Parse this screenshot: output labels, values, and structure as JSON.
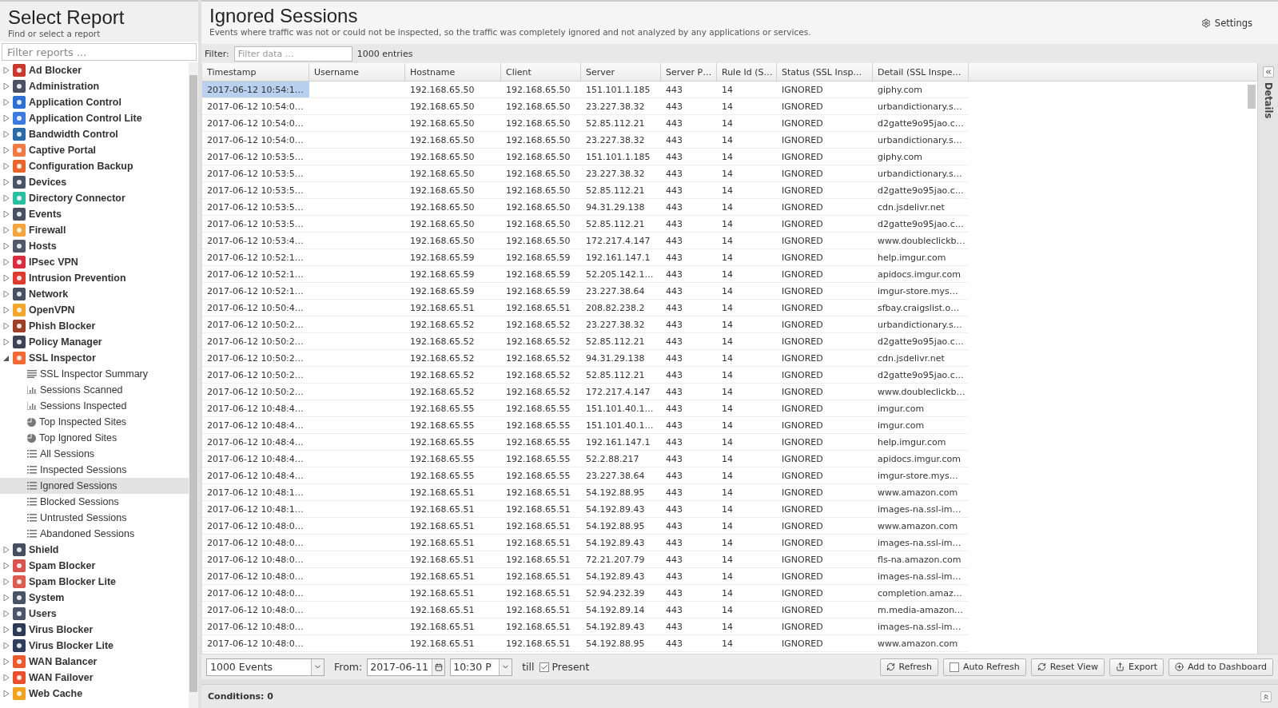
{
  "sidebar": {
    "title": "Select Report",
    "subtitle": "Find or select a report",
    "filter": {
      "placeholder": "Filter reports ..."
    },
    "items": [
      {
        "label": "Ad Blocker",
        "color": "#c83a2e",
        "expanded": false,
        "selected": false
      },
      {
        "label": "Administration",
        "color": "#4a5263",
        "expanded": false,
        "selected": false
      },
      {
        "label": "Application Control",
        "color": "#2f6fd6",
        "expanded": false,
        "selected": false
      },
      {
        "label": "Application Control Lite",
        "color": "#3b7be0",
        "expanded": false,
        "selected": false
      },
      {
        "label": "Bandwidth Control",
        "color": "#2a6aa6",
        "expanded": false,
        "selected": false
      },
      {
        "label": "Captive Portal",
        "color": "#ee7a45",
        "expanded": false,
        "selected": false
      },
      {
        "label": "Configuration Backup",
        "color": "#e4662a",
        "expanded": false,
        "selected": false
      },
      {
        "label": "Devices",
        "color": "#4b5466",
        "expanded": false,
        "selected": false
      },
      {
        "label": "Directory Connector",
        "color": "#2bbf9f",
        "expanded": false,
        "selected": false
      },
      {
        "label": "Events",
        "color": "#474f60",
        "expanded": false,
        "selected": false
      },
      {
        "label": "Firewall",
        "color": "#f2a43a",
        "expanded": false,
        "selected": false
      },
      {
        "label": "Hosts",
        "color": "#505869",
        "expanded": false,
        "selected": false
      },
      {
        "label": "IPsec VPN",
        "color": "#d83040",
        "expanded": false,
        "selected": false
      },
      {
        "label": "Intrusion Prevention",
        "color": "#de3b30",
        "expanded": false,
        "selected": false
      },
      {
        "label": "Network",
        "color": "#485062",
        "expanded": false,
        "selected": false
      },
      {
        "label": "OpenVPN",
        "color": "#f4a72c",
        "expanded": false,
        "selected": false
      },
      {
        "label": "Phish Blocker",
        "color": "#9e3d28",
        "expanded": false,
        "selected": false
      },
      {
        "label": "Policy Manager",
        "color": "#3d4455",
        "expanded": false,
        "selected": false
      },
      {
        "label": "SSL Inspector",
        "color": "#f26a35",
        "expanded": true,
        "selected": false,
        "children": [
          {
            "label": "SSL Inspector Summary",
            "kind": "text",
            "selected": false
          },
          {
            "label": "Sessions Scanned",
            "kind": "bar",
            "selected": false
          },
          {
            "label": "Sessions Inspected",
            "kind": "bar",
            "selected": false
          },
          {
            "label": "Top Inspected Sites",
            "kind": "pie",
            "selected": false
          },
          {
            "label": "Top Ignored Sites",
            "kind": "pie",
            "selected": false
          },
          {
            "label": "All Sessions",
            "kind": "list",
            "selected": false
          },
          {
            "label": "Inspected Sessions",
            "kind": "list",
            "selected": false
          },
          {
            "label": "Ignored Sessions",
            "kind": "list",
            "selected": true
          },
          {
            "label": "Blocked Sessions",
            "kind": "list",
            "selected": false
          },
          {
            "label": "Untrusted Sessions",
            "kind": "list",
            "selected": false
          },
          {
            "label": "Abandoned Sessions",
            "kind": "list",
            "selected": false
          }
        ]
      },
      {
        "label": "Shield",
        "color": "#454d5e",
        "expanded": false,
        "selected": false
      },
      {
        "label": "Spam Blocker",
        "color": "#d9534f",
        "expanded": false,
        "selected": false
      },
      {
        "label": "Spam Blocker Lite",
        "color": "#dc5a50",
        "expanded": false,
        "selected": false
      },
      {
        "label": "System",
        "color": "#4a5366",
        "expanded": false,
        "selected": false
      },
      {
        "label": "Users",
        "color": "#4c5568",
        "expanded": false,
        "selected": false
      },
      {
        "label": "Virus Blocker",
        "color": "#2b3a55",
        "expanded": false,
        "selected": false
      },
      {
        "label": "Virus Blocker Lite",
        "color": "#2d3d5a",
        "expanded": false,
        "selected": false
      },
      {
        "label": "WAN Balancer",
        "color": "#ea5a2e",
        "expanded": false,
        "selected": false
      },
      {
        "label": "WAN Failover",
        "color": "#e8502c",
        "expanded": false,
        "selected": false
      },
      {
        "label": "Web Cache",
        "color": "#f0a21e",
        "expanded": false,
        "selected": false
      }
    ]
  },
  "report": {
    "title": "Ignored Sessions",
    "description": "Events where traffic was not or could not be inspected, so the traffic was completely ignored and not analyzed by any applications or services.",
    "settings": "Settings"
  },
  "filter": {
    "label": "Filter:",
    "placeholder": "Filter data ...",
    "count": "1000 entries"
  },
  "table": {
    "columns": [
      "Timestamp",
      "Username",
      "Hostname",
      "Client",
      "Server",
      "Server P…",
      "Rule Id (S…",
      "Status (SSL Insp…",
      "Detail (SSL Inspe…"
    ],
    "rows": [
      {
        "selected": true,
        "cells": [
          "2017-06-12 10:54:1…",
          "",
          "192.168.65.50",
          "192.168.65.50",
          "151.101.1.185",
          "443",
          "14",
          "IGNORED",
          "giphy.com"
        ]
      },
      {
        "selected": false,
        "cells": [
          "2017-06-12 10:54:0…",
          "",
          "192.168.65.50",
          "192.168.65.50",
          "23.227.38.32",
          "443",
          "14",
          "IGNORED",
          "urbandictionary.s…"
        ]
      },
      {
        "selected": false,
        "cells": [
          "2017-06-12 10:54:0…",
          "",
          "192.168.65.50",
          "192.168.65.50",
          "52.85.112.21",
          "443",
          "14",
          "IGNORED",
          "d2gatte9o95jao.c…"
        ]
      },
      {
        "selected": false,
        "cells": [
          "2017-06-12 10:54:0…",
          "",
          "192.168.65.50",
          "192.168.65.50",
          "23.227.38.32",
          "443",
          "14",
          "IGNORED",
          "urbandictionary.s…"
        ]
      },
      {
        "selected": false,
        "cells": [
          "2017-06-12 10:53:5…",
          "",
          "192.168.65.50",
          "192.168.65.50",
          "151.101.1.185",
          "443",
          "14",
          "IGNORED",
          "giphy.com"
        ]
      },
      {
        "selected": false,
        "cells": [
          "2017-06-12 10:53:5…",
          "",
          "192.168.65.50",
          "192.168.65.50",
          "23.227.38.32",
          "443",
          "14",
          "IGNORED",
          "urbandictionary.s…"
        ]
      },
      {
        "selected": false,
        "cells": [
          "2017-06-12 10:53:5…",
          "",
          "192.168.65.50",
          "192.168.65.50",
          "52.85.112.21",
          "443",
          "14",
          "IGNORED",
          "d2gatte9o95jao.c…"
        ]
      },
      {
        "selected": false,
        "cells": [
          "2017-06-12 10:53:5…",
          "",
          "192.168.65.50",
          "192.168.65.50",
          "94.31.29.138",
          "443",
          "14",
          "IGNORED",
          "cdn.jsdelivr.net"
        ]
      },
      {
        "selected": false,
        "cells": [
          "2017-06-12 10:53:5…",
          "",
          "192.168.65.50",
          "192.168.65.50",
          "52.85.112.21",
          "443",
          "14",
          "IGNORED",
          "d2gatte9o95jao.c…"
        ]
      },
      {
        "selected": false,
        "cells": [
          "2017-06-12 10:53:4…",
          "",
          "192.168.65.50",
          "192.168.65.50",
          "172.217.4.147",
          "443",
          "14",
          "IGNORED",
          "www.doubleclickb…"
        ]
      },
      {
        "selected": false,
        "cells": [
          "2017-06-12 10:52:1…",
          "",
          "192.168.65.59",
          "192.168.65.59",
          "192.161.147.1",
          "443",
          "14",
          "IGNORED",
          "help.imgur.com"
        ]
      },
      {
        "selected": false,
        "cells": [
          "2017-06-12 10:52:1…",
          "",
          "192.168.65.59",
          "192.168.65.59",
          "52.205.142.1…",
          "443",
          "14",
          "IGNORED",
          "apidocs.imgur.com"
        ]
      },
      {
        "selected": false,
        "cells": [
          "2017-06-12 10:52:1…",
          "",
          "192.168.65.59",
          "192.168.65.59",
          "23.227.38.64",
          "443",
          "14",
          "IGNORED",
          "imgur-store.mys…"
        ]
      },
      {
        "selected": false,
        "cells": [
          "2017-06-12 10:50:4…",
          "",
          "192.168.65.51",
          "192.168.65.51",
          "208.82.238.2",
          "443",
          "14",
          "IGNORED",
          "sfbay.craigslist.o…"
        ]
      },
      {
        "selected": false,
        "cells": [
          "2017-06-12 10:50:2…",
          "",
          "192.168.65.52",
          "192.168.65.52",
          "23.227.38.32",
          "443",
          "14",
          "IGNORED",
          "urbandictionary.s…"
        ]
      },
      {
        "selected": false,
        "cells": [
          "2017-06-12 10:50:2…",
          "",
          "192.168.65.52",
          "192.168.65.52",
          "52.85.112.21",
          "443",
          "14",
          "IGNORED",
          "d2gatte9o95jao.c…"
        ]
      },
      {
        "selected": false,
        "cells": [
          "2017-06-12 10:50:2…",
          "",
          "192.168.65.52",
          "192.168.65.52",
          "94.31.29.138",
          "443",
          "14",
          "IGNORED",
          "cdn.jsdelivr.net"
        ]
      },
      {
        "selected": false,
        "cells": [
          "2017-06-12 10:50:2…",
          "",
          "192.168.65.52",
          "192.168.65.52",
          "52.85.112.21",
          "443",
          "14",
          "IGNORED",
          "d2gatte9o95jao.c…"
        ]
      },
      {
        "selected": false,
        "cells": [
          "2017-06-12 10:50:2…",
          "",
          "192.168.65.52",
          "192.168.65.52",
          "172.217.4.147",
          "443",
          "14",
          "IGNORED",
          "www.doubleclickb…"
        ]
      },
      {
        "selected": false,
        "cells": [
          "2017-06-12 10:48:4…",
          "",
          "192.168.65.55",
          "192.168.65.55",
          "151.101.40.1…",
          "443",
          "14",
          "IGNORED",
          "imgur.com"
        ]
      },
      {
        "selected": false,
        "cells": [
          "2017-06-12 10:48:4…",
          "",
          "192.168.65.55",
          "192.168.65.55",
          "151.101.40.1…",
          "443",
          "14",
          "IGNORED",
          "imgur.com"
        ]
      },
      {
        "selected": false,
        "cells": [
          "2017-06-12 10:48:4…",
          "",
          "192.168.65.55",
          "192.168.65.55",
          "192.161.147.1",
          "443",
          "14",
          "IGNORED",
          "help.imgur.com"
        ]
      },
      {
        "selected": false,
        "cells": [
          "2017-06-12 10:48:4…",
          "",
          "192.168.65.55",
          "192.168.65.55",
          "52.2.88.217",
          "443",
          "14",
          "IGNORED",
          "apidocs.imgur.com"
        ]
      },
      {
        "selected": false,
        "cells": [
          "2017-06-12 10:48:4…",
          "",
          "192.168.65.55",
          "192.168.65.55",
          "23.227.38.64",
          "443",
          "14",
          "IGNORED",
          "imgur-store.mys…"
        ]
      },
      {
        "selected": false,
        "cells": [
          "2017-06-12 10:48:1…",
          "",
          "192.168.65.51",
          "192.168.65.51",
          "54.192.88.95",
          "443",
          "14",
          "IGNORED",
          "www.amazon.com"
        ]
      },
      {
        "selected": false,
        "cells": [
          "2017-06-12 10:48:1…",
          "",
          "192.168.65.51",
          "192.168.65.51",
          "54.192.89.43",
          "443",
          "14",
          "IGNORED",
          "images-na.ssl-im…"
        ]
      },
      {
        "selected": false,
        "cells": [
          "2017-06-12 10:48:0…",
          "",
          "192.168.65.51",
          "192.168.65.51",
          "54.192.88.95",
          "443",
          "14",
          "IGNORED",
          "www.amazon.com"
        ]
      },
      {
        "selected": false,
        "cells": [
          "2017-06-12 10:48:0…",
          "",
          "192.168.65.51",
          "192.168.65.51",
          "54.192.89.43",
          "443",
          "14",
          "IGNORED",
          "images-na.ssl-im…"
        ]
      },
      {
        "selected": false,
        "cells": [
          "2017-06-12 10:48:0…",
          "",
          "192.168.65.51",
          "192.168.65.51",
          "72.21.207.79",
          "443",
          "14",
          "IGNORED",
          "fls-na.amazon.com"
        ]
      },
      {
        "selected": false,
        "cells": [
          "2017-06-12 10:48:0…",
          "",
          "192.168.65.51",
          "192.168.65.51",
          "54.192.89.43",
          "443",
          "14",
          "IGNORED",
          "images-na.ssl-im…"
        ]
      },
      {
        "selected": false,
        "cells": [
          "2017-06-12 10:48:0…",
          "",
          "192.168.65.51",
          "192.168.65.51",
          "52.94.232.39",
          "443",
          "14",
          "IGNORED",
          "completion.amaz…"
        ]
      },
      {
        "selected": false,
        "cells": [
          "2017-06-12 10:48:0…",
          "",
          "192.168.65.51",
          "192.168.65.51",
          "54.192.89.14",
          "443",
          "14",
          "IGNORED",
          "m.media-amazon…"
        ]
      },
      {
        "selected": false,
        "cells": [
          "2017-06-12 10:48:0…",
          "",
          "192.168.65.51",
          "192.168.65.51",
          "54.192.89.43",
          "443",
          "14",
          "IGNORED",
          "images-na.ssl-im…"
        ]
      },
      {
        "selected": false,
        "cells": [
          "2017-06-12 10:48:0…",
          "",
          "192.168.65.51",
          "192.168.65.51",
          "54.192.88.95",
          "443",
          "14",
          "IGNORED",
          "www.amazon.com"
        ]
      }
    ]
  },
  "details_tab": "Details",
  "toolbar": {
    "events": "1000 Events",
    "from_label": "From:",
    "from_date": "2017-06-11",
    "from_time": "10:30 P",
    "till_label": "till",
    "present": {
      "label": "Present",
      "checked": true
    },
    "buttons": [
      {
        "label": "Refresh",
        "kind": "refresh"
      },
      {
        "label": "Auto Refresh",
        "kind": "toggle",
        "checked": false
      },
      {
        "label": "Reset View",
        "kind": "reset"
      },
      {
        "label": "Export",
        "kind": "export"
      },
      {
        "label": "Add to Dashboard",
        "kind": "add"
      }
    ]
  },
  "conditions": "Conditions: 0"
}
